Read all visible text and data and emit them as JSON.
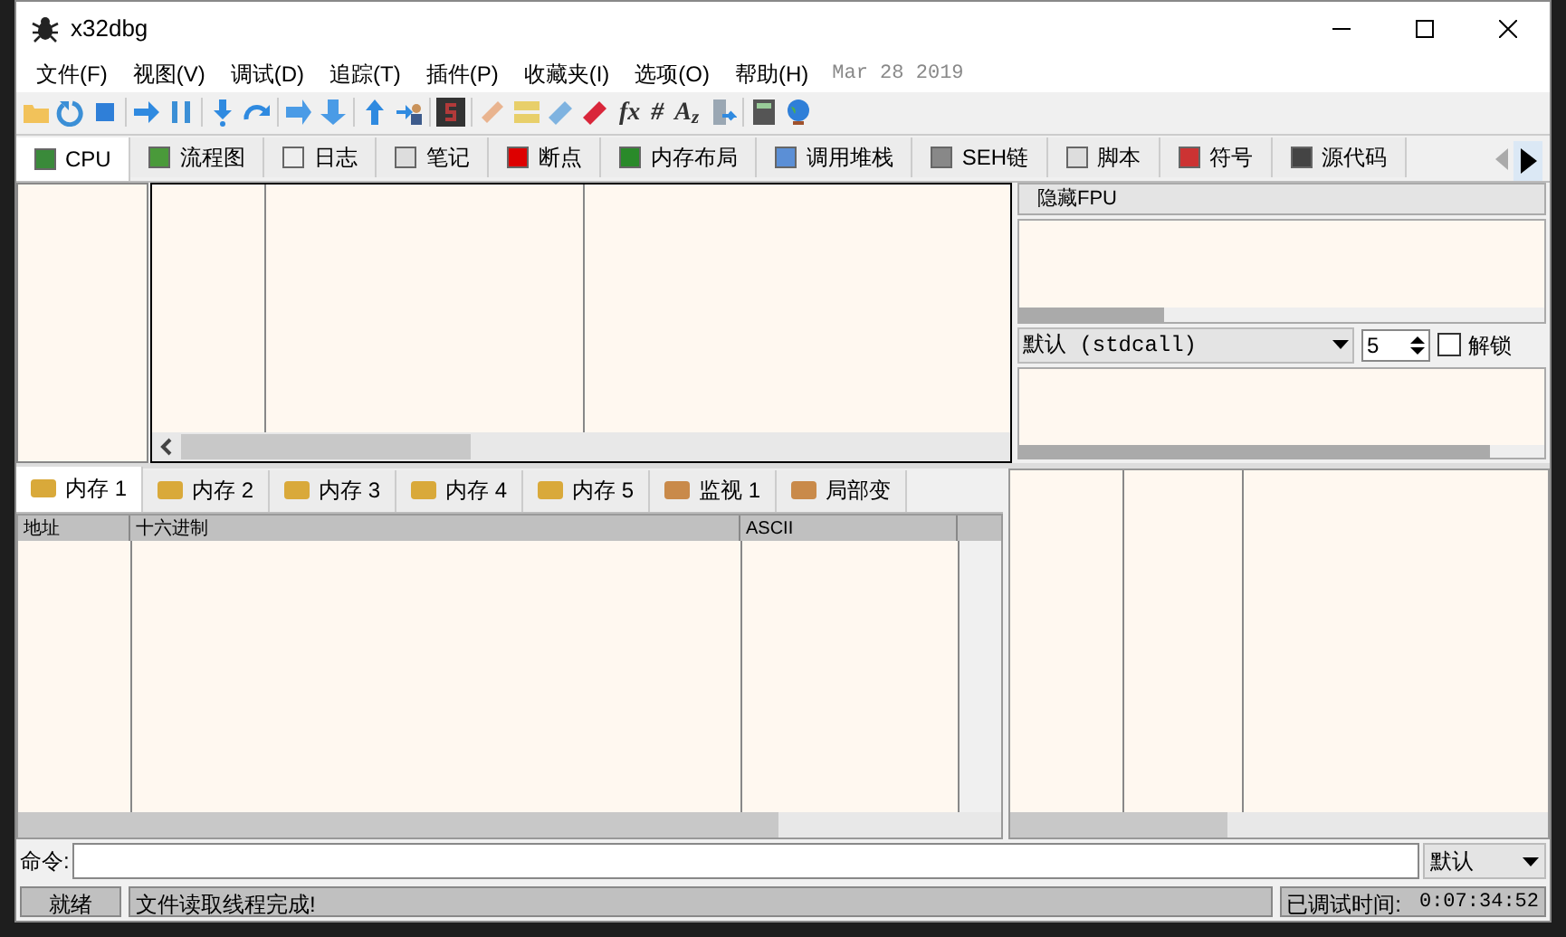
{
  "window": {
    "title": "x32dbg"
  },
  "menu": [
    {
      "label": "文件(F)"
    },
    {
      "label": "视图(V)"
    },
    {
      "label": "调试(D)"
    },
    {
      "label": "追踪(T)"
    },
    {
      "label": "插件(P)"
    },
    {
      "label": "收藏夹(I)"
    },
    {
      "label": "选项(O)"
    },
    {
      "label": "帮助(H)"
    }
  ],
  "build_date": "Mar 28 2019",
  "toolbar_glyphs": [
    "fx",
    "#",
    "A$_{z}$"
  ],
  "top_tabs": [
    {
      "label": "CPU",
      "selected": true
    },
    {
      "label": "流程图",
      "selected": false
    },
    {
      "label": "日志",
      "selected": false
    },
    {
      "label": "笔记",
      "selected": false
    },
    {
      "label": "断点",
      "selected": false
    },
    {
      "label": "内存布局",
      "selected": false
    },
    {
      "label": "调用堆栈",
      "selected": false
    },
    {
      "label": "SEH链",
      "selected": false
    },
    {
      "label": "脚本",
      "selected": false
    },
    {
      "label": "符号",
      "selected": false
    },
    {
      "label": "源代码",
      "selected": false
    }
  ],
  "registers": {
    "fpu_button": "隐藏FPU",
    "calling_convention": "默认 (stdcall)",
    "arg_count": "5",
    "unlock": {
      "label": "解锁",
      "checked": false
    }
  },
  "bottom_tabs": [
    {
      "label": "内存 1",
      "selected": true
    },
    {
      "label": "内存 2",
      "selected": false
    },
    {
      "label": "内存 3",
      "selected": false
    },
    {
      "label": "内存 4",
      "selected": false
    },
    {
      "label": "内存 5",
      "selected": false
    },
    {
      "label": "监视 1",
      "selected": false
    },
    {
      "label": "局部变",
      "selected": false
    }
  ],
  "dump": {
    "columns": [
      "地址",
      "十六进制",
      "ASCII"
    ]
  },
  "command": {
    "label": "命令:",
    "mode": "默认"
  },
  "status_bar": {
    "state": "就绪",
    "message": "文件读取线程完成!",
    "timer_label": "已调试时间:",
    "time": "0:07:34:52"
  }
}
